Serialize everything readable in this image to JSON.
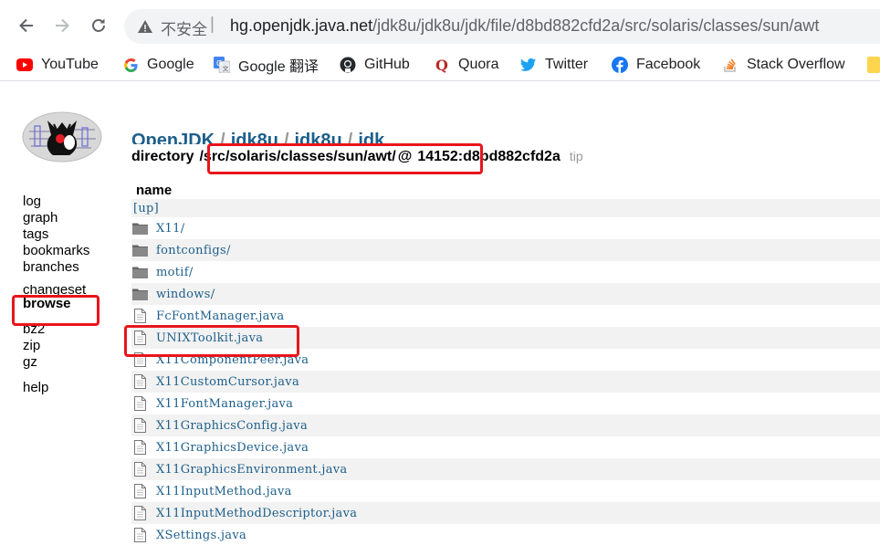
{
  "browser": {
    "security_label": "不安全",
    "separator": "|",
    "url_host": "hg.openjdk.java.net",
    "url_path": "/jdk8u/jdk8u/jdk/file/d8bd882cfd2a/src/solaris/classes/sun/awt",
    "icons": [
      "back-arrow-icon",
      "forward-arrow-icon",
      "reload-icon",
      "warning-icon"
    ]
  },
  "bookmarks": [
    {
      "label": "YouTube",
      "icon": "youtube-icon",
      "color": "#ff0000"
    },
    {
      "label": "Google",
      "icon": "google-icon",
      "color": "#4285f4"
    },
    {
      "label": "Google 翻译",
      "icon": "google-translate-icon",
      "color": "#4285f4"
    },
    {
      "label": "GitHub",
      "icon": "github-icon",
      "color": "#24292e"
    },
    {
      "label": "Quora",
      "icon": "quora-icon",
      "color": "#b92b27"
    },
    {
      "label": "Twitter",
      "icon": "twitter-icon",
      "color": "#1da1f2"
    },
    {
      "label": "Facebook",
      "icon": "facebook-icon",
      "color": "#1877f2"
    },
    {
      "label": "Stack Overflow",
      "icon": "stackoverflow-icon",
      "color": "#f48024"
    }
  ],
  "sidebar": {
    "group1": [
      "log",
      "graph",
      "tags",
      "bookmarks",
      "branches"
    ],
    "changeset": "changeset",
    "browse": "browse",
    "group3": [
      "bz2",
      "zip",
      "gz"
    ],
    "help": "help"
  },
  "breadcrumb": [
    "OpenJDK",
    "jdk8u",
    "jdk8u",
    "jdk"
  ],
  "breadcrumb_separator": "/",
  "directory": {
    "label": "directory",
    "path": "/src/solaris/classes/sun/awt/",
    "at": "@",
    "revision": "14152:d8bd882cfd2a",
    "tip": "tip"
  },
  "listing": {
    "header": "name",
    "up": "[up]",
    "folders": [
      "X11/",
      "fontconfigs/",
      "motif/",
      "windows/"
    ],
    "files": [
      "FcFontManager.java",
      "UNIXToolkit.java",
      "X11ComponentPeer.java",
      "X11CustomCursor.java",
      "X11FontManager.java",
      "X11GraphicsConfig.java",
      "X11GraphicsDevice.java",
      "X11GraphicsEnvironment.java",
      "X11InputMethod.java",
      "X11InputMethodDescriptor.java",
      "XSettings.java"
    ]
  },
  "colors": {
    "link": "#1d5f8a",
    "highlight_box": "#e8151b",
    "row_alt": "#f2f2f2"
  }
}
